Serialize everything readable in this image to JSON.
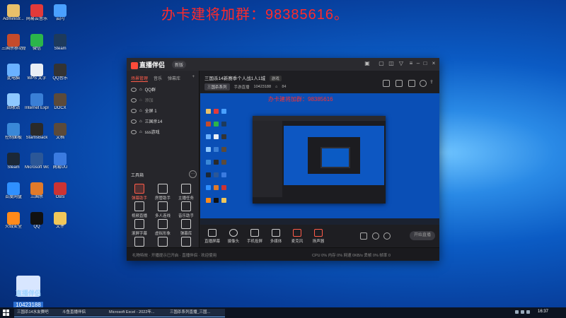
{
  "overlay_banner": "办卡建将加群：98385616。",
  "desktop_icons": [
    {
      "label": "Administr...",
      "color": "#e8c06a"
    },
    {
      "label": "网易云音乐",
      "color": "#e23a3a"
    },
    {
      "label": "云闪",
      "color": "#4aa0ff"
    },
    {
      "label": "三国杀移动版",
      "color": "#c44b2b"
    },
    {
      "label": "微信",
      "color": "#2bb54a"
    },
    {
      "label": "Steam",
      "color": "#1d3a5c"
    },
    {
      "label": "此电脑",
      "color": "#6ab1ff"
    },
    {
      "label": "WPS 文字",
      "color": "#e9eef5"
    },
    {
      "label": "QQ音乐",
      "color": "#333333"
    },
    {
      "label": "回收站",
      "color": "#8ec8ff"
    },
    {
      "label": "Internet Explorer",
      "color": "#3a7fd6"
    },
    {
      "label": "DOCX",
      "color": "#5b4a3a"
    },
    {
      "label": "控制面板",
      "color": "#3a88d8"
    },
    {
      "label": "StartIsBack",
      "color": "#2a2a2a"
    },
    {
      "label": "文档",
      "color": "#5b4a3a"
    },
    {
      "label": "Steam",
      "color": "#1b2838"
    },
    {
      "label": "Microsoft Word",
      "color": "#2b5797"
    },
    {
      "label": "网易UU",
      "color": "#3b7be0"
    },
    {
      "label": "百度网盘",
      "color": "#2f90ff"
    },
    {
      "label": "三国杀",
      "color": "#e07a2a"
    },
    {
      "label": "OBS",
      "color": "#c33"
    },
    {
      "label": "火绒安全",
      "color": "#ff8a1a"
    },
    {
      "label": "QQ",
      "color": "#111111"
    },
    {
      "label": "文件",
      "color": "#f0c75a"
    }
  ],
  "streamer_badge": {
    "name": "直播伴侣",
    "id": "10423188"
  },
  "app": {
    "logo": "直播伴侣",
    "version": "新版",
    "left_tabs": [
      "场景管理",
      "音乐",
      "弹幕库"
    ],
    "scenes": [
      {
        "name": "QQ群",
        "dim": false
      },
      {
        "name": "添加",
        "dim": true
      },
      {
        "name": "全屏 1",
        "dim": false
      },
      {
        "name": "三国杀14",
        "dim": false
      },
      {
        "name": "sss游戏",
        "dim": false
      }
    ],
    "tools_header": "工具箱",
    "tools_more": "···",
    "tools": [
      {
        "label": "弹幕助手",
        "hot": true
      },
      {
        "label": "房管助手",
        "hot": false
      },
      {
        "label": "主播任务",
        "hot": false
      },
      {
        "label": "视频直播",
        "hot": false
      },
      {
        "label": "多人连线",
        "hot": false
      },
      {
        "label": "音乐助手",
        "hot": false
      },
      {
        "label": "滚屏字幕",
        "hot": false
      },
      {
        "label": "虚拟形象",
        "hot": false
      },
      {
        "label": "弹幕库",
        "hot": false
      },
      {
        "label": "礼物特效",
        "hot": false
      },
      {
        "label": "PK",
        "hot": false
      },
      {
        "label": "下载",
        "hot": false
      }
    ],
    "room_title": "三国杀14新赛季个人战1人1城",
    "room_tag": "游戏",
    "room_category": "三国杀系列",
    "room_type": "手游直播",
    "room_id": "10423188",
    "fans": "84",
    "preview_watermark": "办卡建将加群：98385616",
    "bottom_buttons": [
      "直播屏幕",
      "摄像头",
      "手机投屏",
      "多媒体",
      "麦克风",
      "扬声器"
    ],
    "go_live": "开始直播",
    "status_left": "礼物特效 · 开播提示已开启 · 直播伴侣 · 欢迎使用",
    "status_right": "CPU 0%  内存 0%  网速 0KB/s  丢帧 0%  帧率 0"
  },
  "taskbar": {
    "tasks": [
      "三国杀14水友赛吧",
      "斗鱼直播伴侣",
      "Microsoft Excel - 2022年...",
      "三国杀系列直播_三国..."
    ],
    "time": "16:37"
  }
}
